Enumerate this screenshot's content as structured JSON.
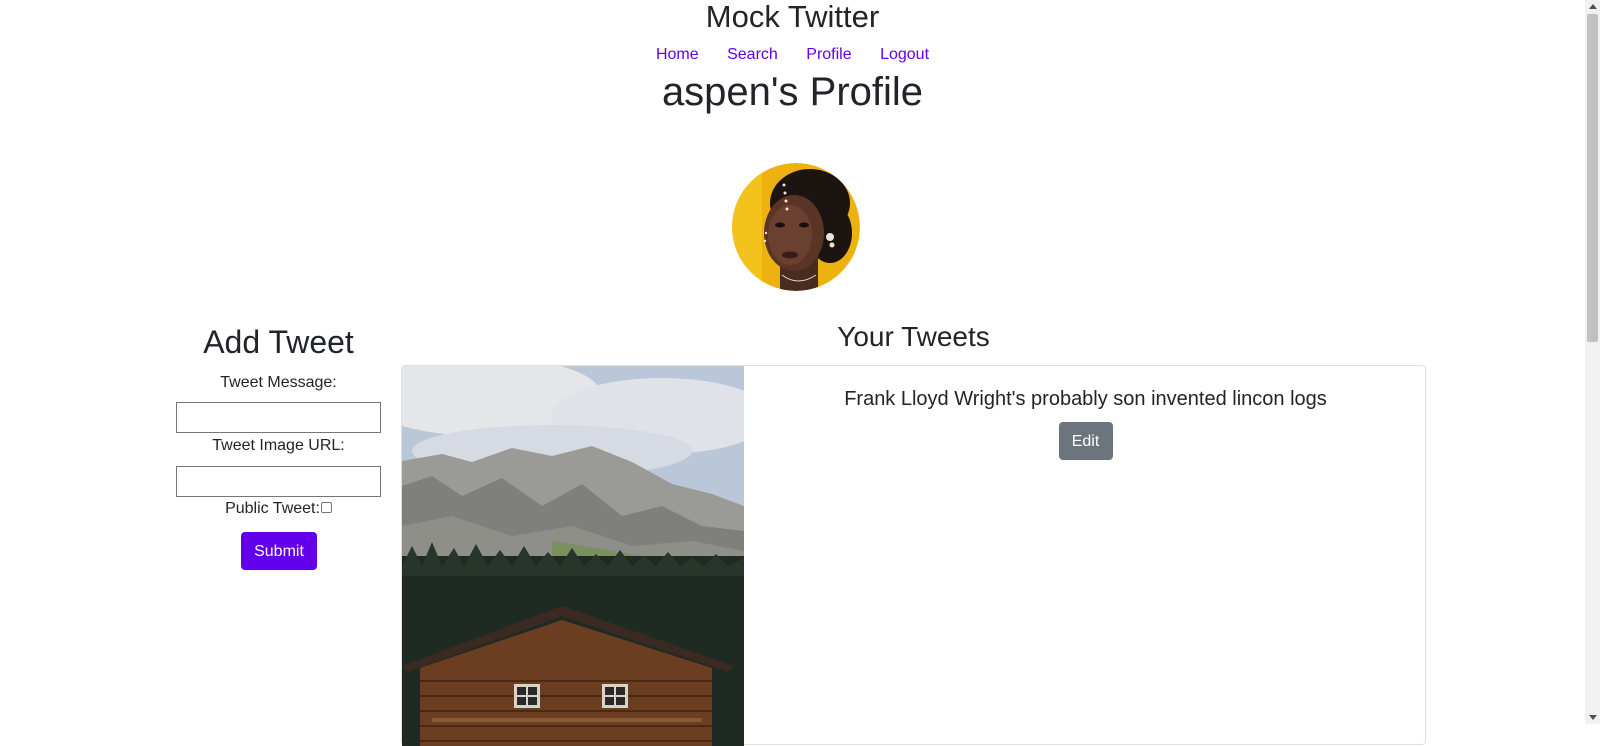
{
  "header": {
    "site_title": "Mock Twitter",
    "nav": [
      "Home",
      "Search",
      "Profile",
      "Logout"
    ]
  },
  "profile": {
    "title": "aspen's Profile"
  },
  "add_tweet": {
    "heading": "Add Tweet",
    "message_label": "Tweet Message:",
    "message_value": "",
    "image_label": "Tweet Image URL:",
    "image_value": "",
    "public_label": "Public Tweet:",
    "public_checked": false,
    "submit_label": "Submit"
  },
  "tweets": {
    "heading": "Your Tweets",
    "items": [
      {
        "text": "Frank Lloyd Wright's probably son invented lincon logs",
        "edit_label": "Edit"
      }
    ]
  },
  "colors": {
    "link": "#6200ee",
    "primary_button": "#6200ee",
    "secondary_button": "#6c757d",
    "text": "#212529"
  }
}
